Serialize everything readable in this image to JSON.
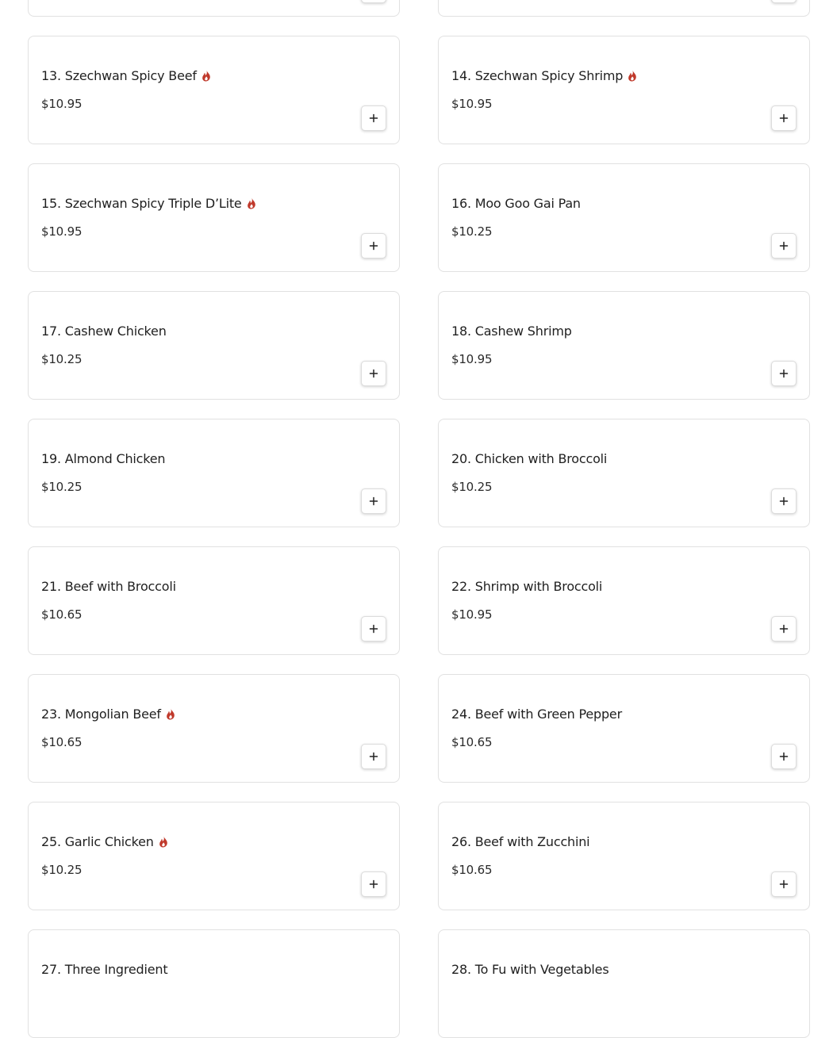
{
  "accent_color": "#c0392b",
  "icons": {
    "spicy": "flame-icon",
    "add": "plus-icon"
  },
  "menu_items": [
    {
      "name": "",
      "price": "",
      "spicy": false
    },
    {
      "name": "",
      "price": "",
      "spicy": false
    },
    {
      "name": "13. Szechwan Spicy Beef",
      "price": "$10.95",
      "spicy": true
    },
    {
      "name": "14. Szechwan Spicy Shrimp",
      "price": "$10.95",
      "spicy": true
    },
    {
      "name": "15. Szechwan Spicy Triple D’Lite",
      "price": "$10.95",
      "spicy": true
    },
    {
      "name": "16. Moo Goo Gai Pan",
      "price": "$10.25",
      "spicy": false
    },
    {
      "name": "17. Cashew Chicken",
      "price": "$10.25",
      "spicy": false
    },
    {
      "name": "18. Cashew Shrimp",
      "price": "$10.95",
      "spicy": false
    },
    {
      "name": "19. Almond Chicken",
      "price": "$10.25",
      "spicy": false
    },
    {
      "name": "20. Chicken with Broccoli",
      "price": "$10.25",
      "spicy": false
    },
    {
      "name": "21. Beef with Broccoli",
      "price": "$10.65",
      "spicy": false
    },
    {
      "name": "22. Shrimp with Broccoli",
      "price": "$10.95",
      "spicy": false
    },
    {
      "name": "23. Mongolian Beef",
      "price": "$10.65",
      "spicy": true
    },
    {
      "name": "24. Beef with Green Pepper",
      "price": "$10.65",
      "spicy": false
    },
    {
      "name": "25. Garlic Chicken",
      "price": "$10.25",
      "spicy": true
    },
    {
      "name": "26. Beef with Zucchini",
      "price": "$10.65",
      "spicy": false
    },
    {
      "name": "27. Three Ingredient",
      "price": "",
      "spicy": false
    },
    {
      "name": "28. To Fu with Vegetables",
      "price": "",
      "spicy": false
    }
  ]
}
